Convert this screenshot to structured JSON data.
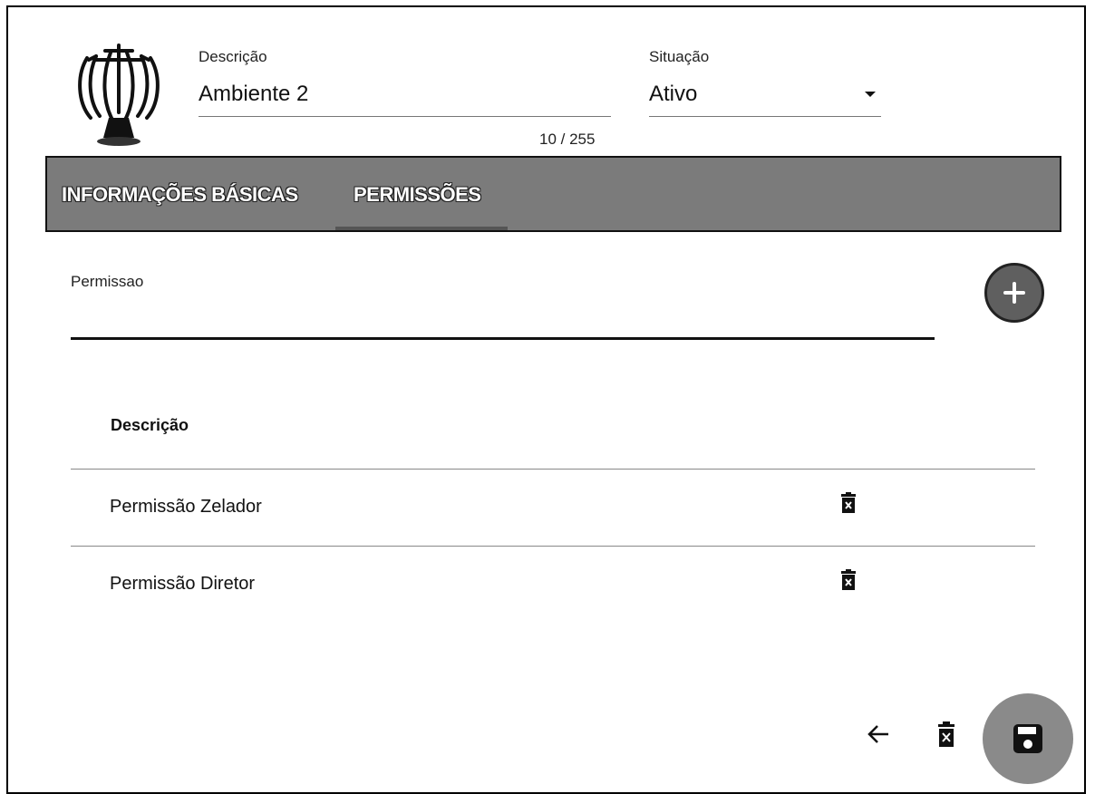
{
  "header": {
    "descricao_label": "Descrição",
    "descricao_value": "Ambiente 2",
    "descricao_counter": "10 / 255",
    "situacao_label": "Situação",
    "situacao_value": "Ativo"
  },
  "tabs": [
    {
      "label": "INFORMAÇÕES BÁSICAS",
      "active": false
    },
    {
      "label": "PERMISSÕES",
      "active": true
    }
  ],
  "permissao": {
    "label": "Permissao",
    "add_icon": "plus-icon"
  },
  "table": {
    "header": "Descrição",
    "rows": [
      {
        "descricao": "Permissão Zelador",
        "action_icon": "delete-icon"
      },
      {
        "descricao": "Permissão Diretor",
        "action_icon": "delete-icon"
      }
    ]
  },
  "footer_actions": {
    "back_icon": "arrow-left-icon",
    "delete_icon": "delete-icon",
    "save_icon": "save-icon"
  },
  "colors": {
    "tabbar": "#7b7b7b",
    "add_button": "#5f5f5f",
    "save_button": "#8a8a8a"
  }
}
